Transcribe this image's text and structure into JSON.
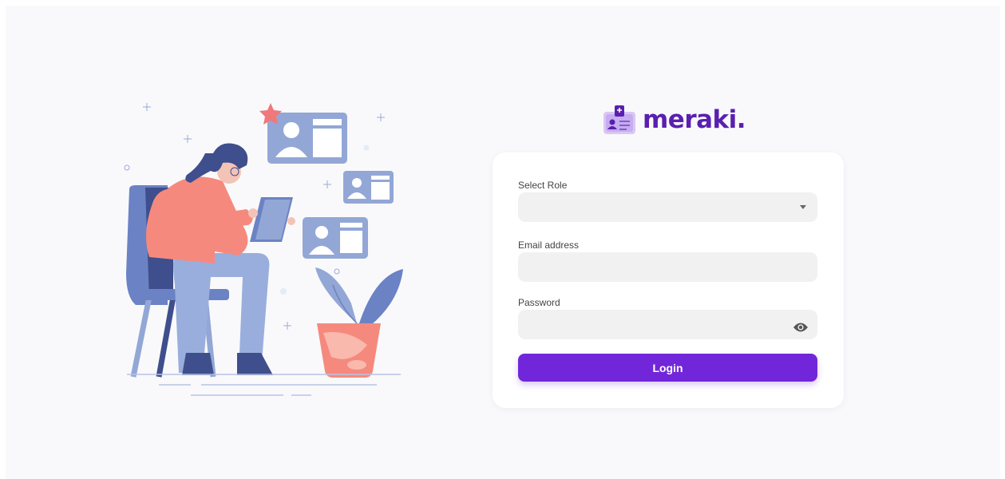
{
  "brand": {
    "name": "meraki.",
    "logo_icon": "id-card-icon",
    "color": "#5a1fb0"
  },
  "form": {
    "role_label": "Select Role",
    "role_value": "",
    "email_label": "Email address",
    "email_value": "",
    "password_label": "Password",
    "password_value": "",
    "password_toggle_icon": "eye-icon",
    "login_label": "Login"
  },
  "colors": {
    "accent": "#7127d9",
    "background": "#f9f9fb",
    "card": "#ffffff",
    "field": "#f1f1f1"
  },
  "illustration": {
    "description_icon": "woman-with-tablet-illustration"
  }
}
